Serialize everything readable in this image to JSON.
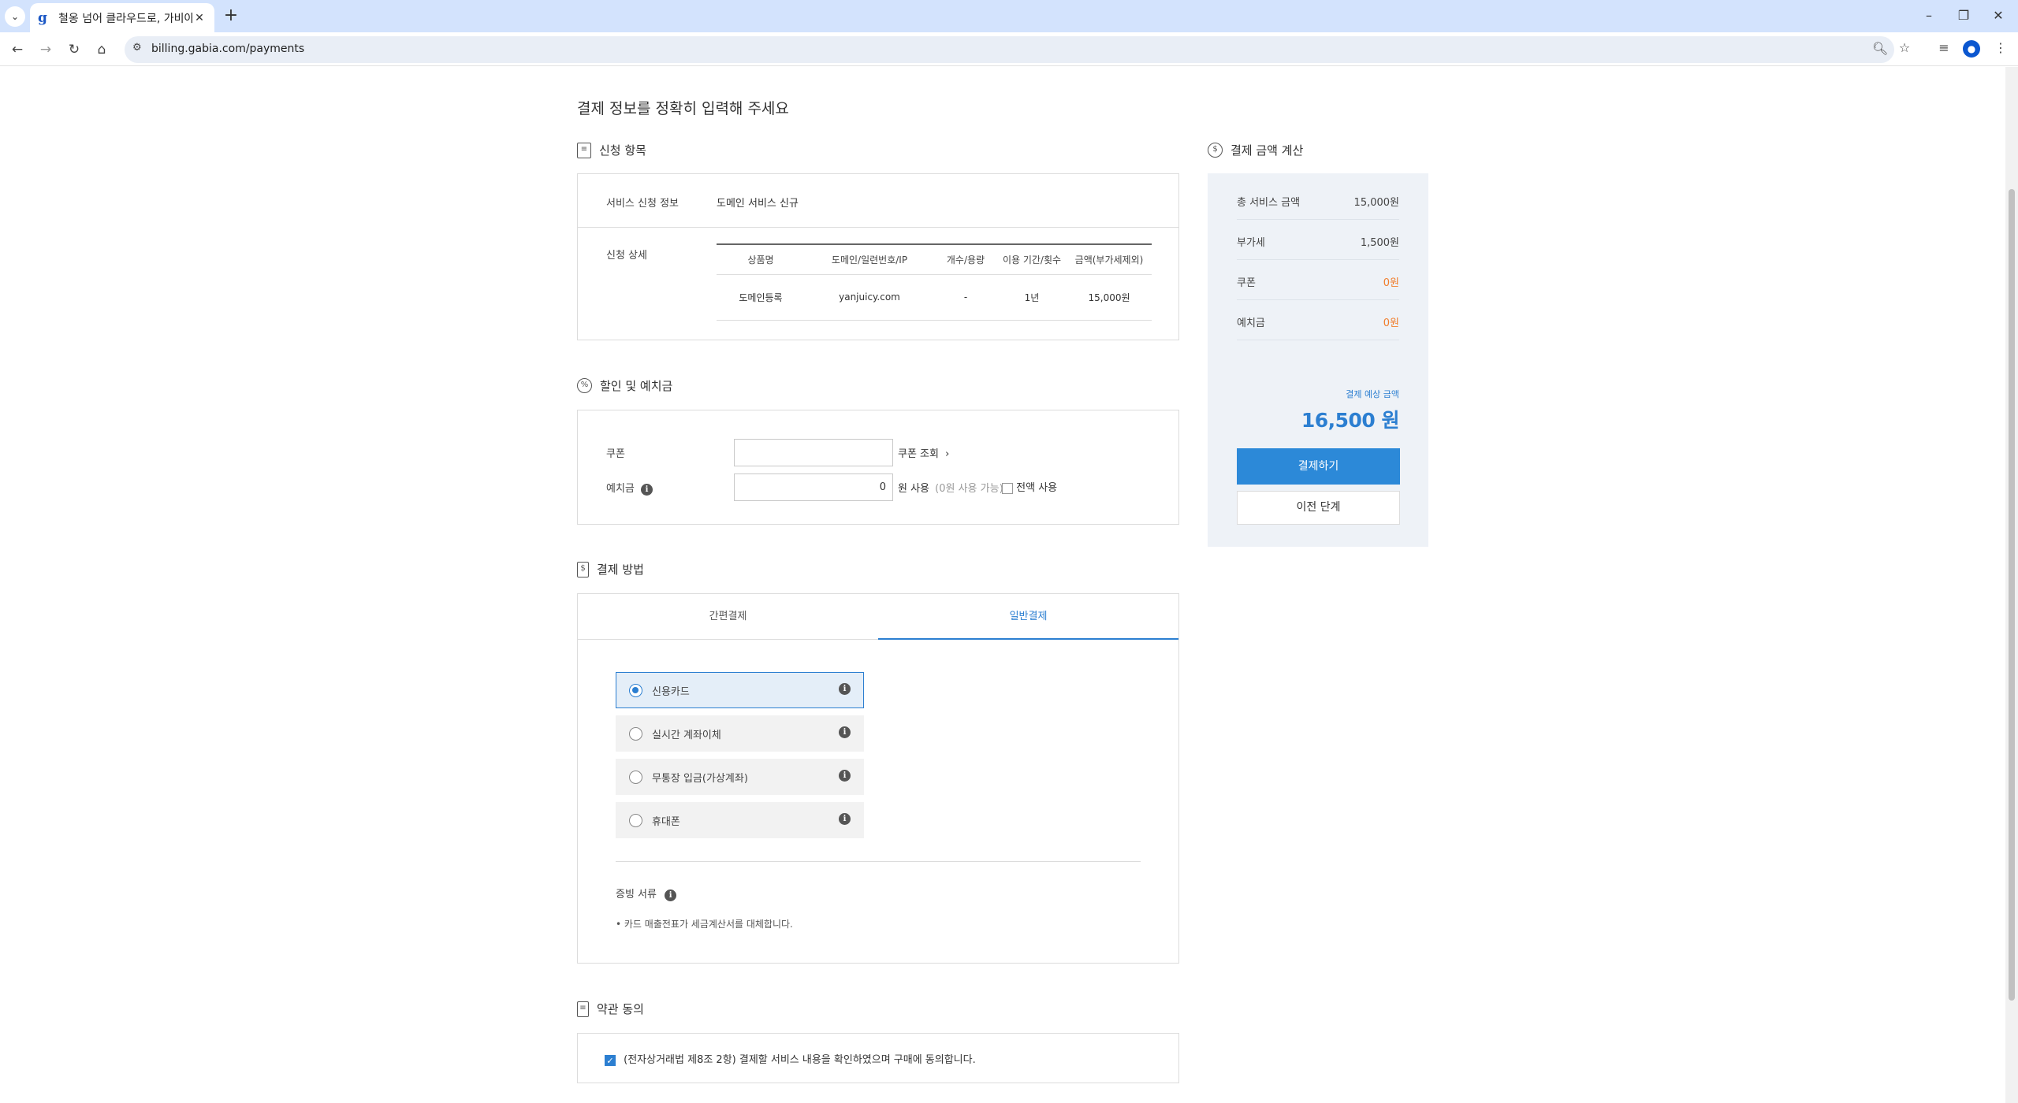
{
  "browser": {
    "tab_title": "철옹 넘어 클라우드로, 가비아",
    "favicon": "g",
    "url": "billing.gabia.com/payments"
  },
  "page": {
    "title": "결제 정보를 정확히 입력해 주세요"
  },
  "application": {
    "section_title": "신청 항목",
    "service_info_label": "서비스 신청 정보",
    "service_info_value": "도메인 서비스 신규",
    "detail_label": "신청 상세",
    "table": {
      "headers": [
        "상품명",
        "도메인/일련번호/IP",
        "개수/용량",
        "이용 기간/횟수",
        "금액(부가세제외)"
      ],
      "rows": [
        [
          "도메인등록",
          "yanjuicy.com",
          "-",
          "1년",
          "15,000원"
        ]
      ]
    }
  },
  "discount": {
    "section_title": "할인 및 예치금",
    "coupon_label": "쿠폰",
    "coupon_value": "",
    "coupon_lookup": "쿠폰 조회",
    "deposit_label": "예치금",
    "deposit_value": "0",
    "deposit_use": "원 사용",
    "deposit_available": "(0원 사용 가능)",
    "use_all": "전액 사용"
  },
  "payment": {
    "section_title": "결제 방법",
    "tabs": [
      "간편결제",
      "일반결제"
    ],
    "active_tab": "일반결제",
    "methods": [
      "신용카드",
      "실시간 계좌이체",
      "무통장 입금(가상계좌)",
      "휴대폰"
    ],
    "selected_method": "신용카드",
    "receipt_label": "증빙 서류",
    "receipt_note": "• 카드 매출전표가 세금계산서를 대체합니다."
  },
  "terms": {
    "section_title": "약관 동의",
    "agree_text": "(전자상거래법 제8조 2항) 결제할 서비스 내용을 확인하였으며 구매에 동의합니다.",
    "agreed": true
  },
  "summary": {
    "section_title": "결제 금액 계산",
    "rows": [
      {
        "label": "총 서비스 금액",
        "value": "15,000원"
      },
      {
        "label": "부가세",
        "value": "1,500원"
      },
      {
        "label": "쿠폰",
        "value": "0원"
      },
      {
        "label": "예치금",
        "value": "0원"
      }
    ],
    "expected_label": "결제 예상 금액",
    "expected_value": "16,500 원",
    "pay_button": "결제하기",
    "back_button": "이전 단계",
    "accent_color": "#2c89d8",
    "discount_color": "#f07d2b"
  }
}
